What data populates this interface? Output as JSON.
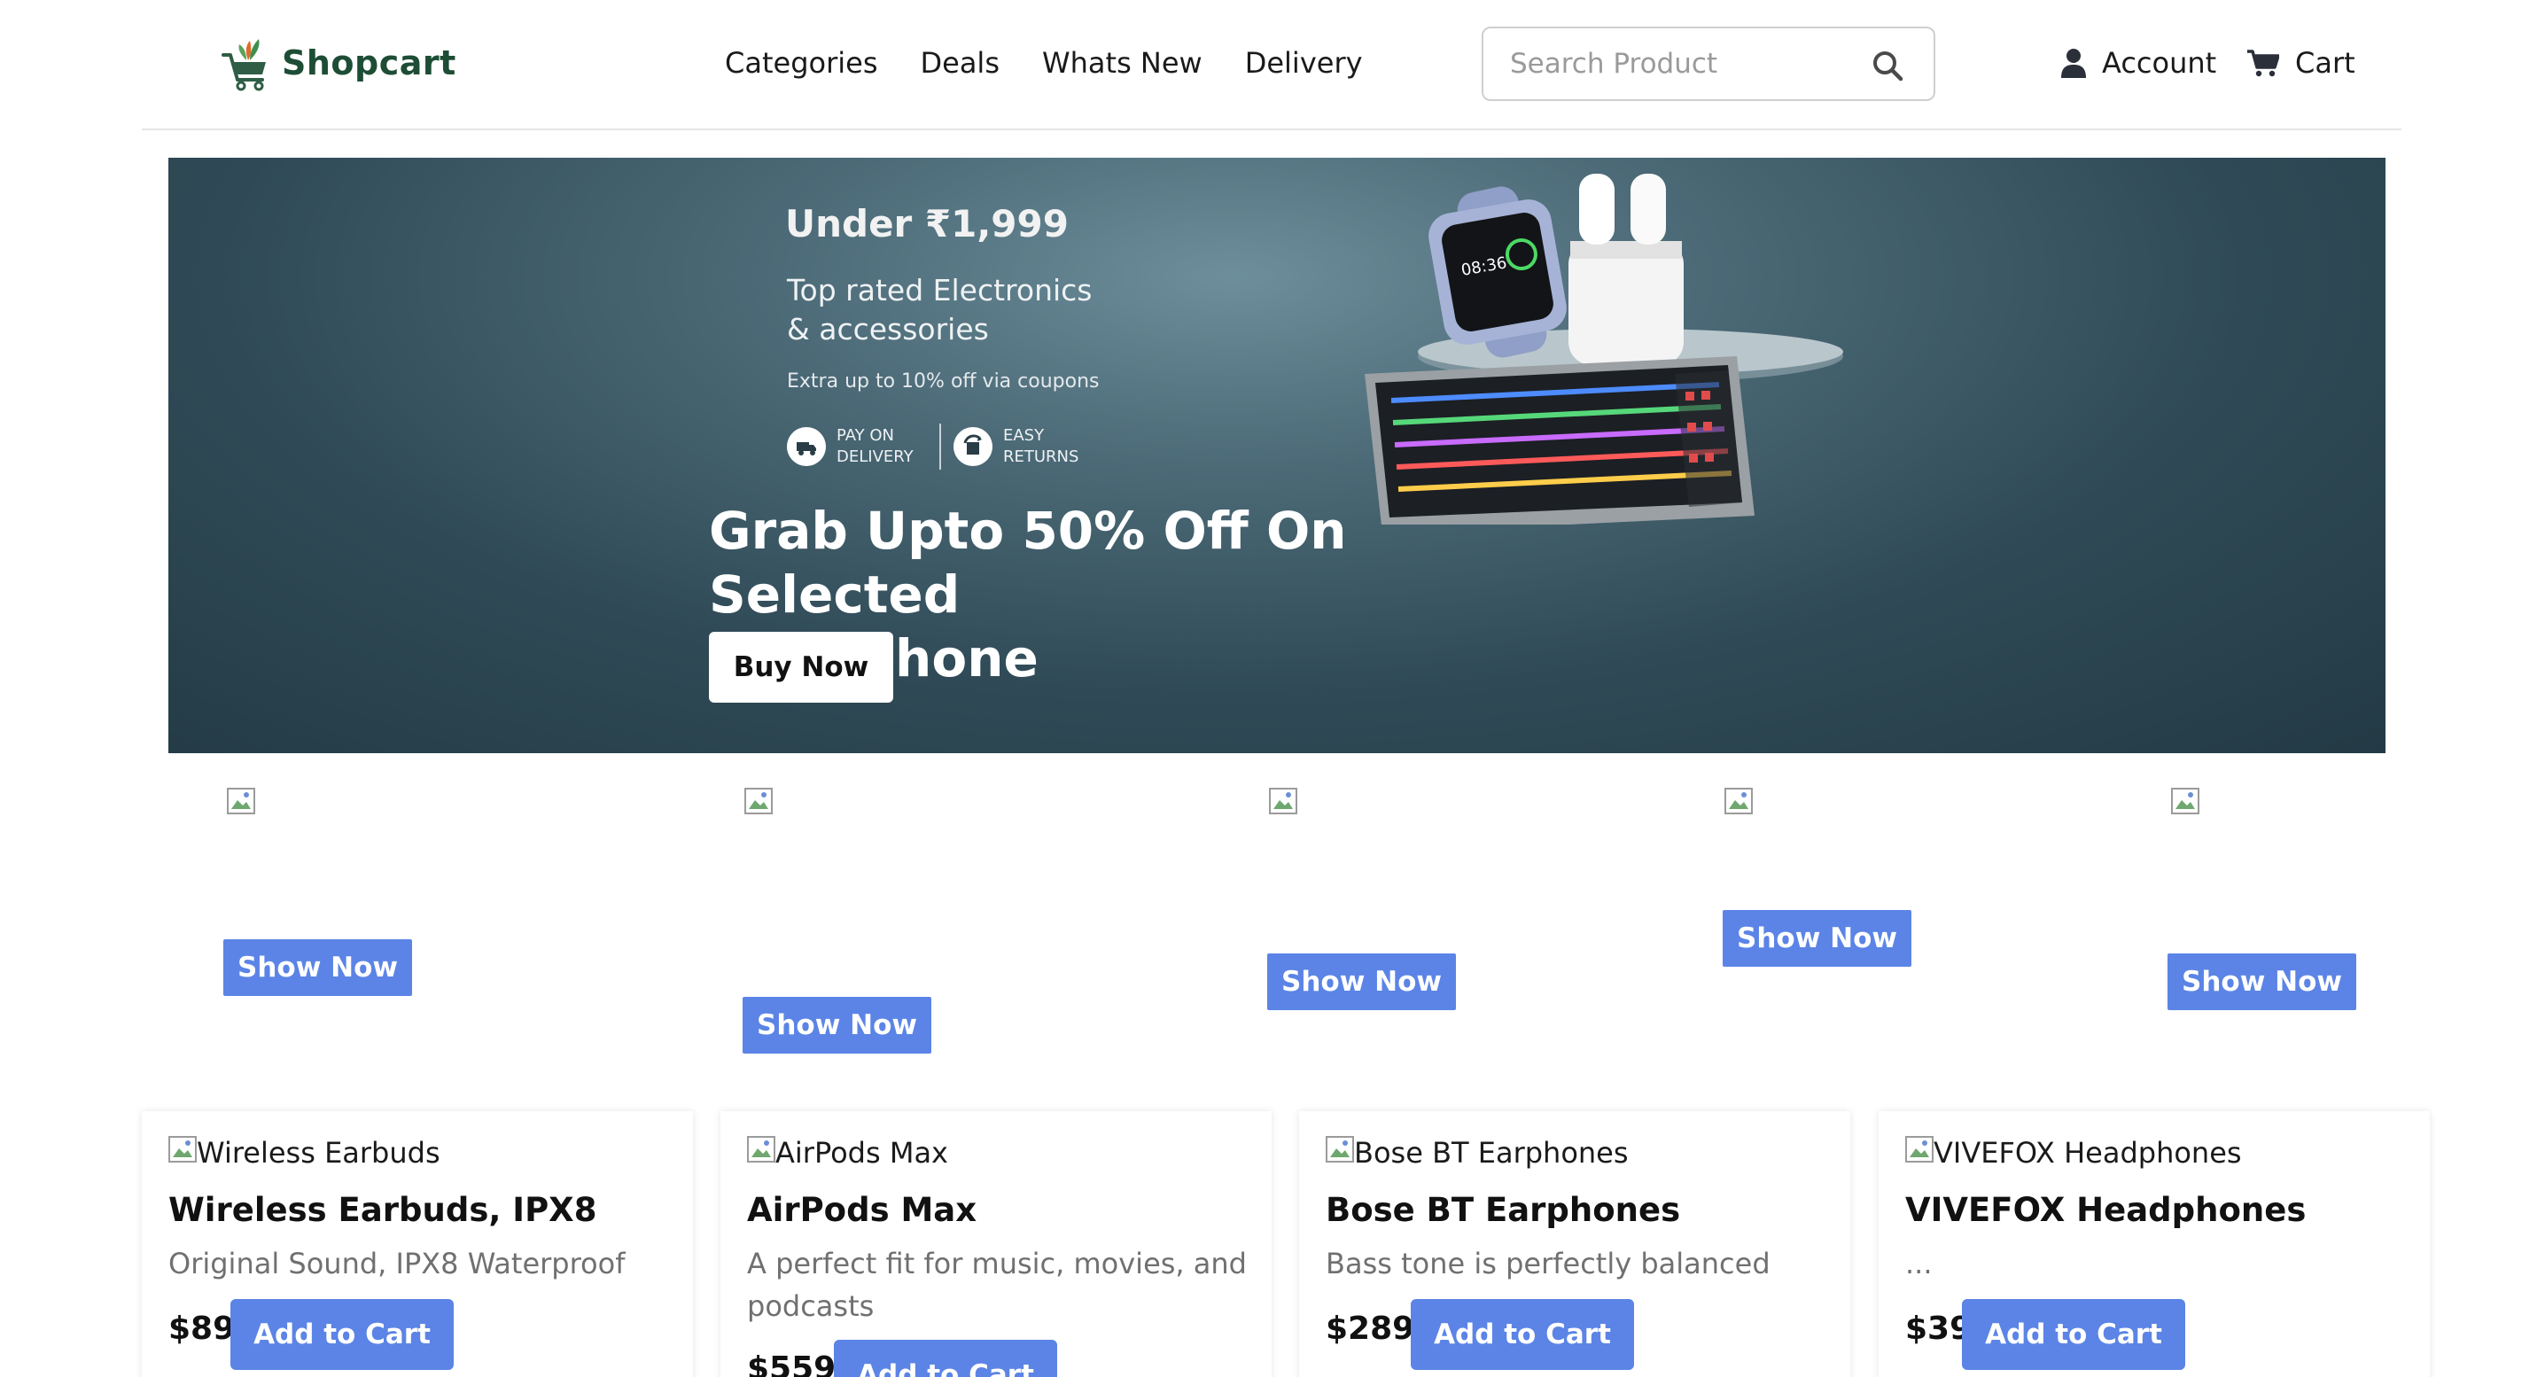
{
  "header": {
    "logo_text": "Shopcart",
    "nav": [
      "Categories",
      "Deals",
      "Whats New",
      "Delivery"
    ],
    "search": {
      "placeholder": "Search Product",
      "value": ""
    },
    "account_label": "Account",
    "cart_label": "Cart",
    "brand_color": "#1d4d35"
  },
  "hero": {
    "under_text": "Under ₹1,999",
    "top_line1": "Top rated Electronics",
    "top_line2": "& accessories",
    "extra_text": "Extra up to 10% off via coupons",
    "badge1_line1": "PAY ON",
    "badge1_line2": "DELIVERY",
    "badge2_line1": "EASY",
    "badge2_line2": "RETURNS",
    "title_line1": "Grab Upto 50% Off On Selected",
    "title_line2": "Headphone",
    "button_label": "Buy Now"
  },
  "categories": {
    "button_label": "Show Now",
    "accent": "#5b84e6"
  },
  "products": [
    {
      "img_alt": "Wireless Earbuds",
      "title": "Wireless Earbuds, IPX8",
      "desc": "Original Sound, IPX8 Waterproof",
      "price": "$89",
      "button": "Add to Cart"
    },
    {
      "img_alt": "AirPods Max",
      "title": "AirPods Max",
      "desc": "A perfect fit for music, movies, and podcasts",
      "price": "$559",
      "button": "Add to Cart"
    },
    {
      "img_alt": "Bose BT Earphones",
      "title": "Bose BT Earphones",
      "desc": "Bass tone is perfectly balanced",
      "price": "$289",
      "button": "Add to Cart"
    },
    {
      "img_alt": "VIVEFOX Headphones",
      "title": "VIVEFOX Headphones",
      "desc": "...",
      "price": "$39",
      "button": "Add to Cart"
    }
  ]
}
